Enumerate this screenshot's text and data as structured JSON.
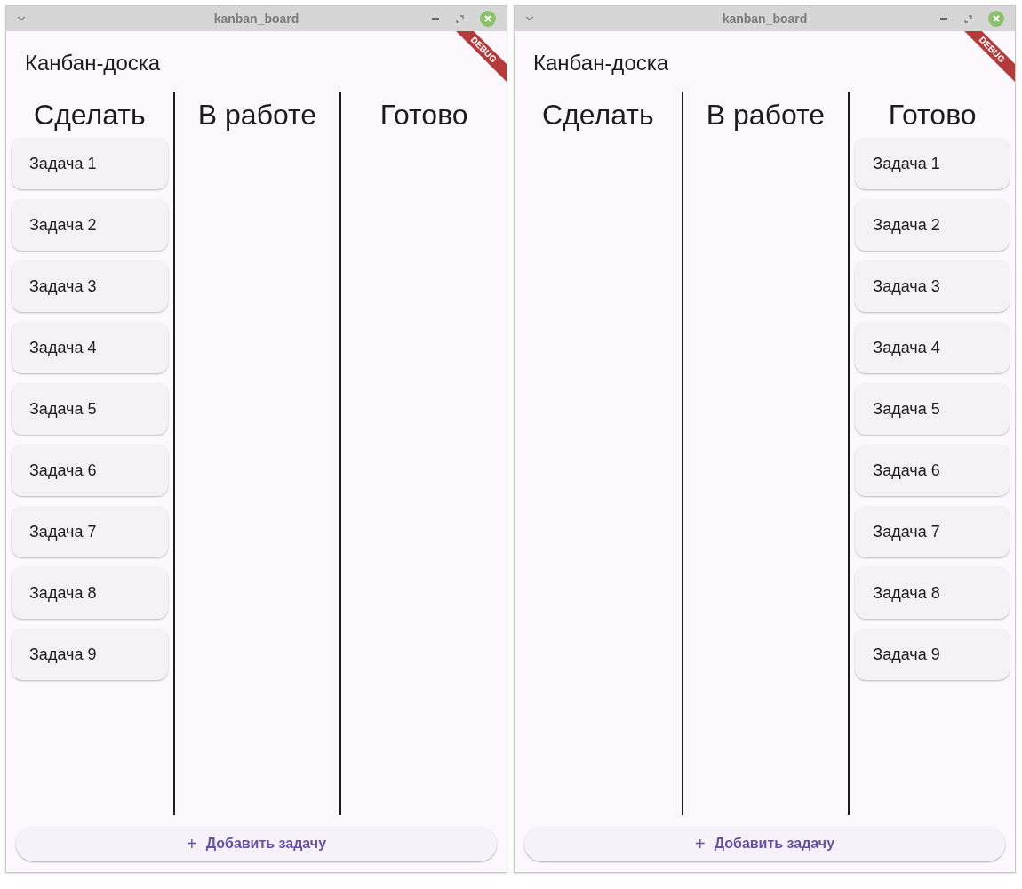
{
  "windows": [
    {
      "title": "kanban_board",
      "app_title": "Канбан-доска",
      "debug_banner": "DEBUG",
      "columns": [
        {
          "title": "Сделать",
          "cards": [
            "Задача 1",
            "Задача 2",
            "Задача 3",
            "Задача 4",
            "Задача 5",
            "Задача 6",
            "Задача 7",
            "Задача 8",
            "Задача 9"
          ]
        },
        {
          "title": "В работе"
        },
        {
          "title": "Готово"
        }
      ],
      "add_button": {
        "icon": "+",
        "label": "Добавить задачу"
      }
    },
    {
      "title": "kanban_board",
      "app_title": "Канбан-доска",
      "debug_banner": "DEBUG",
      "columns": [
        {
          "title": "Сделать"
        },
        {
          "title": "В работе"
        },
        {
          "title": "Готово",
          "cards": [
            "Задача 1",
            "Задача 2",
            "Задача 3",
            "Задача 4",
            "Задача 5",
            "Задача 6",
            "Задача 7",
            "Задача 8",
            "Задача 9"
          ]
        }
      ],
      "add_button": {
        "icon": "+",
        "label": "Добавить задачу"
      }
    }
  ]
}
